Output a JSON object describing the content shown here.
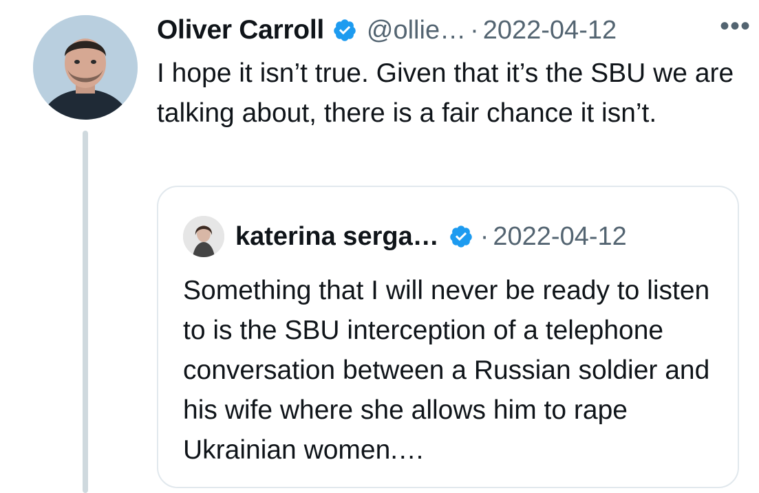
{
  "tweet": {
    "author_name": "Oliver Carroll",
    "handle": "@ollie…",
    "separator": "·",
    "date": "2022-04-12",
    "more_label": "•••",
    "text": "I hope it isn’t true. Given that it’s the SBU we are talking about, there is a fair chance it isn’t.",
    "verified_color": "#1d9bf0"
  },
  "quote": {
    "author_name": "katerina serga…",
    "separator": "·",
    "date": "2022-04-12",
    "text": "Something that I will never be ready to listen to is the SBU interception of a telephone conversation between a Russian soldier and his wife where she allows him to rape Ukrainian women.…"
  }
}
